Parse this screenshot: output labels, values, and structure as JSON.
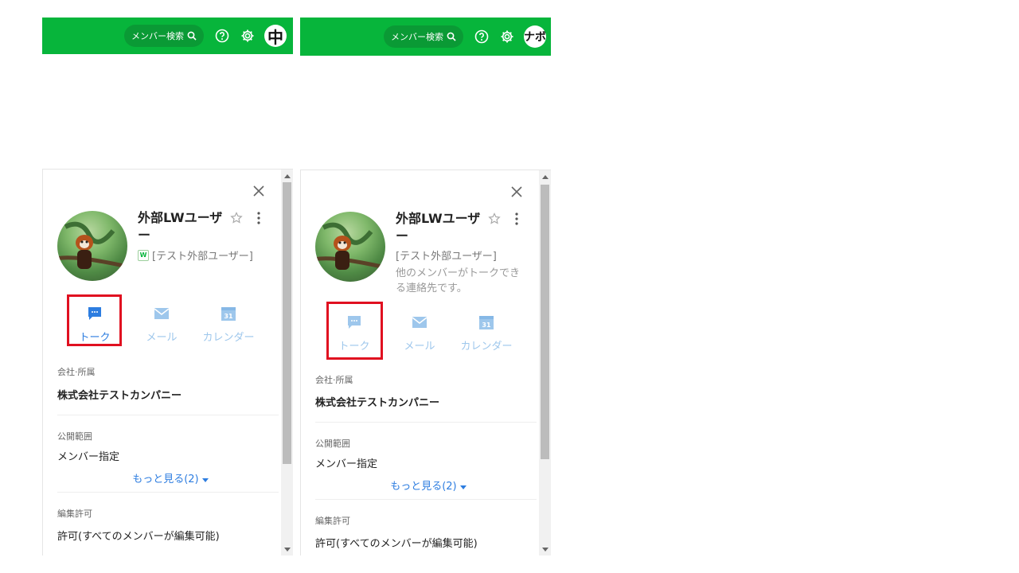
{
  "colors": {
    "header_bg": "#07b53b",
    "accent_blue": "#2d7de0",
    "disabled_blue": "#9ec7ec",
    "highlight_red": "#e01020"
  },
  "header": {
    "search_label": "メンバー検索",
    "avatar_left": "中",
    "avatar_right": "ナボ"
  },
  "profile": {
    "name": "外部LWユーザー",
    "tag": "[テスト外部ユーザー]",
    "description": "他のメンバーがトークできる連絡先です。",
    "actions": {
      "talk": "トーク",
      "mail": "メール",
      "calendar": "カレンダー",
      "calendar_day": "31"
    },
    "company_label": "会社·所属",
    "company_value": "株式会社テストカンパニー",
    "scope_label": "公開範囲",
    "scope_value": "メンバー指定",
    "more_link": "もっと見る(2)",
    "edit_label": "編集許可",
    "edit_value": "許可(すべてのメンバーが編集可能)"
  }
}
